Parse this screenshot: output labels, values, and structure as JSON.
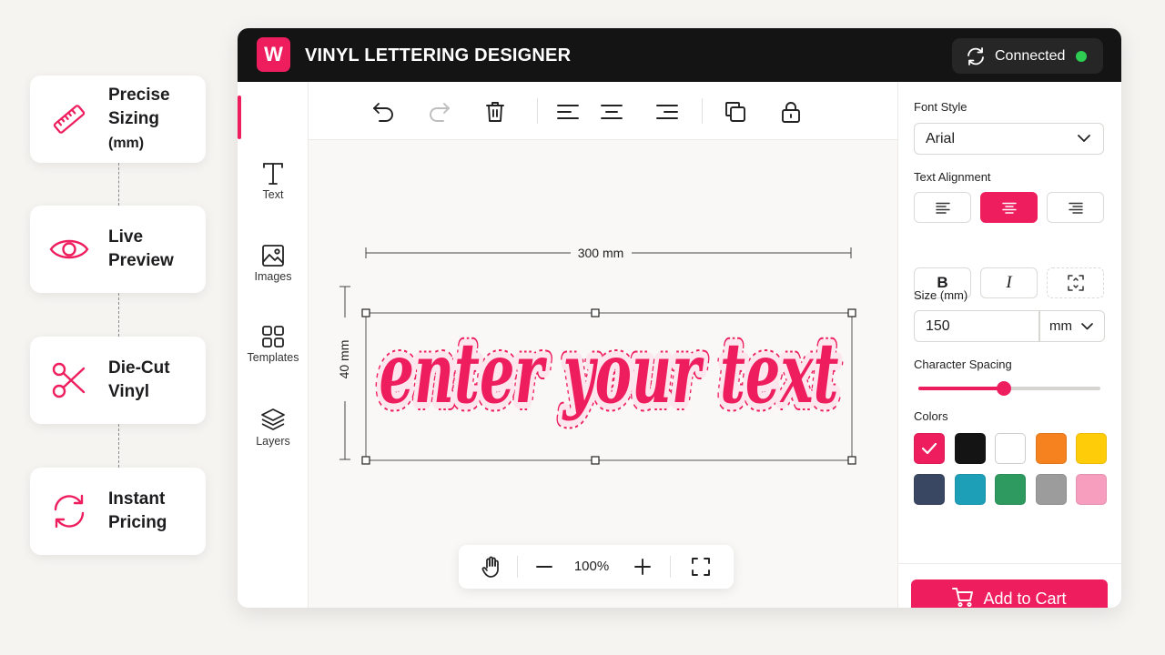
{
  "features": [
    {
      "label_line1": "Precise",
      "label_line2": "Sizing",
      "label_suffix": "(mm)",
      "icon": "ruler-icon"
    },
    {
      "label_line1": "Live",
      "label_line2": "Preview",
      "icon": "eye-icon"
    },
    {
      "label_line1": "Die-Cut",
      "label_line2": "Vinyl",
      "icon": "scissors-icon"
    },
    {
      "label_line1": "Instant",
      "label_line2": "Pricing",
      "icon": "refresh-icon"
    }
  ],
  "app": {
    "logo_letter": "W",
    "title": "VINYL LETTERING DESIGNER",
    "status": "Connected",
    "accent_color": "#ee1e5e",
    "status_color": "#2ecc52"
  },
  "rail": {
    "items": [
      {
        "label": "Text",
        "icon": "text-icon"
      },
      {
        "label": "Images",
        "icon": "image-icon"
      },
      {
        "label": "Templates",
        "icon": "grid-icon"
      },
      {
        "label": "Layers",
        "icon": "layers-icon"
      }
    ]
  },
  "toolbar": {
    "buttons": [
      "undo-icon",
      "redo-icon",
      "trash-icon",
      "align-left-icon",
      "align-center-icon",
      "align-right-icon",
      "duplicate-icon",
      "lock-icon"
    ]
  },
  "canvas": {
    "design_text": "enter your text",
    "width_label": "300 mm",
    "height_label": "40 mm",
    "text_color": "#ee1e5e"
  },
  "panel": {
    "font_style_label": "Font Style",
    "font_value": "Arial",
    "alignment_label": "Text Alignment",
    "alignment_selected": "center",
    "bold_label": "B",
    "italic_label": "I",
    "size_label": "Size (mm)",
    "size_value": "150",
    "unit_value": "mm",
    "spacing_label": "Character Spacing",
    "spacing_fraction": 0.47,
    "colors_label": "Colors",
    "colors": [
      "#ee1e5e",
      "#141414",
      "#ffffff",
      "#f5821f",
      "#ffcc0a",
      "#3a4763",
      "#1e9fb8",
      "#2e9a5f",
      "#9c9c9c",
      "#f79ebf"
    ],
    "selected_color_index": 0,
    "cart_label": "Add to Cart"
  },
  "zoom": {
    "value": "100%"
  }
}
